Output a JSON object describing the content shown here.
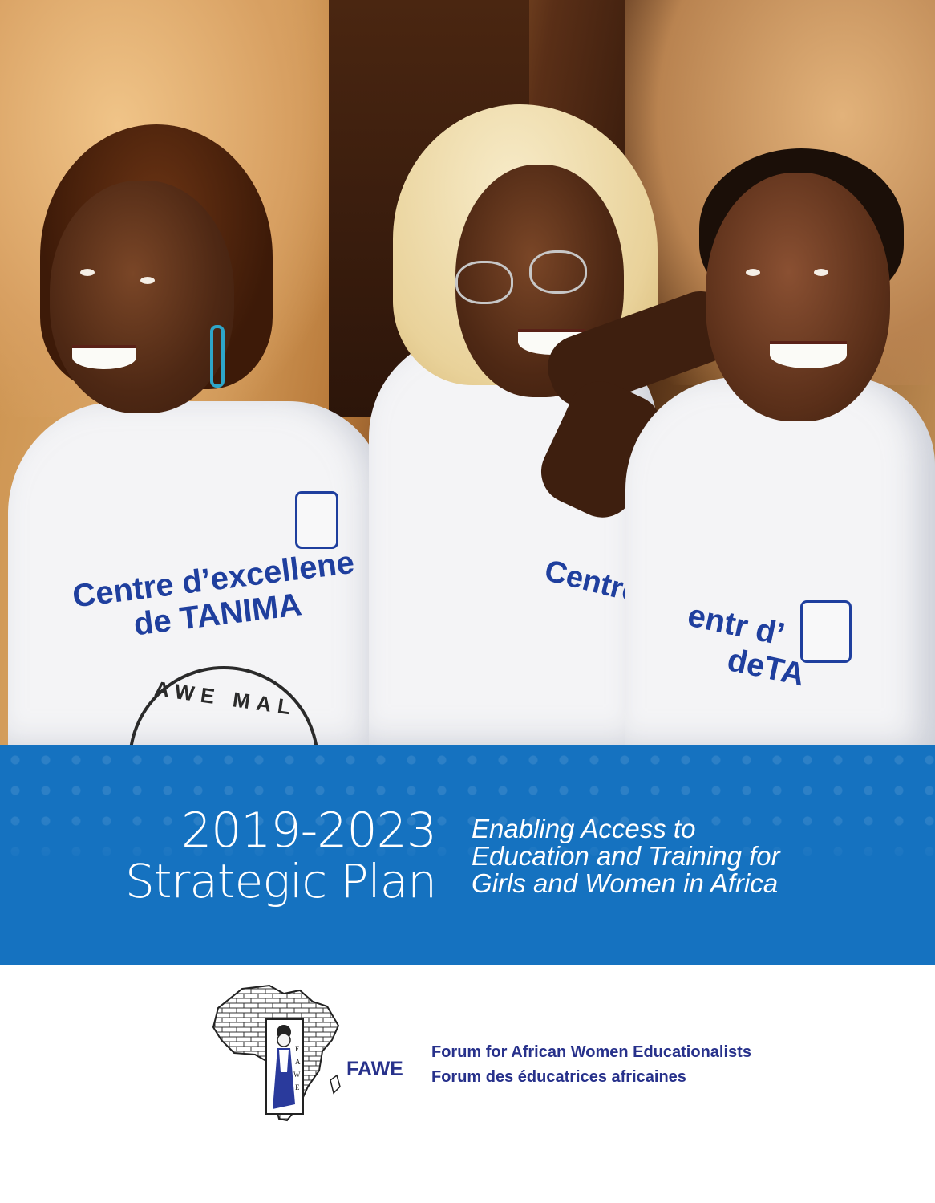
{
  "hero": {
    "shirt_text_left": [
      "Centre d’excellene",
      "de TANIMA"
    ],
    "shirt_text_middle": [
      "Centre"
    ],
    "shirt_text_right": [
      "entr d’",
      "deTA"
    ],
    "seal_text": "AWE MAL"
  },
  "title": {
    "years": "2019-2023",
    "plan": "Strategic Plan",
    "subtitle_lines": [
      "Enabling Access to",
      "Education and Training for",
      "Girls and Women in Africa"
    ]
  },
  "logo": {
    "acronym": "FAWE",
    "name_en": "Forum for African Women Educationalists",
    "name_fr": "Forum des éducatrices africaines"
  },
  "colors": {
    "band_blue": "#1572c0",
    "logo_blue": "#27318b",
    "shirt_print_blue": "#1f3f9e"
  }
}
